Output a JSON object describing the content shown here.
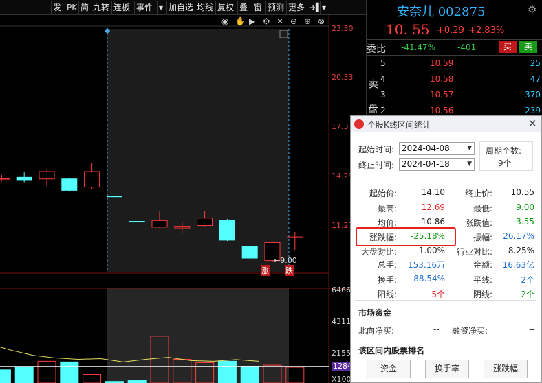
{
  "toolbar": {
    "items": [
      "发",
      "PK",
      "简",
      "九转",
      "连板",
      "事件",
      "▾",
      "加自选",
      "均线",
      "复权",
      "叠",
      "窗",
      "预测",
      "更多",
      "➜▌",
      "▾"
    ]
  },
  "chart": {
    "price_ticks": [
      "23.30",
      "20.33",
      "17.3",
      "14.29",
      "11.27"
    ],
    "volume_ticks": [
      "6466",
      "4311",
      "2155",
      "1284",
      "X100"
    ],
    "low_marker": "9.00",
    "zhang_label": "涨",
    "die_label": "跌",
    "candles": [
      {
        "open": 14.13,
        "close": 14.13,
        "high": 14.35,
        "low": 13.95,
        "color": "red",
        "filled": false
      },
      {
        "open": 14.2,
        "close": 14.05,
        "high": 14.5,
        "low": 13.9,
        "color": "cyan",
        "filled": true
      },
      {
        "open": 14.1,
        "close": 14.55,
        "high": 14.7,
        "low": 13.65,
        "color": "red",
        "filled": false
      },
      {
        "open": 14.1,
        "close": 13.4,
        "high": 14.2,
        "low": 13.3,
        "color": "cyan",
        "filled": true
      },
      {
        "open": 13.6,
        "close": 14.55,
        "high": 15.05,
        "low": 13.5,
        "color": "red",
        "filled": false
      },
      {
        "open": 13.05,
        "close": 13.05,
        "high": 13.05,
        "low": 13.05,
        "color": "cyan",
        "filled": true
      },
      {
        "open": 11.5,
        "close": 11.5,
        "high": 11.5,
        "low": 11.5,
        "color": "cyan",
        "filled": true
      },
      {
        "open": 11.15,
        "close": 11.55,
        "high": 12.1,
        "low": 11.1,
        "color": "red",
        "filled": false
      },
      {
        "open": 11.2,
        "close": 11.1,
        "high": 11.5,
        "low": 10.8,
        "color": "red",
        "filled": false
      },
      {
        "open": 11.25,
        "close": 11.7,
        "high": 12.15,
        "low": 11.2,
        "color": "red",
        "filled": false
      },
      {
        "open": 11.55,
        "close": 10.35,
        "high": 11.65,
        "low": 10.3,
        "color": "cyan",
        "filled": true
      },
      {
        "open": 9.95,
        "close": 9.25,
        "high": 9.95,
        "low": 9.2,
        "color": "cyan",
        "filled": true
      },
      {
        "open": 9.1,
        "close": 10.2,
        "high": 10.2,
        "low": 9.0,
        "color": "red",
        "filled": false
      },
      {
        "open": 10.55,
        "close": 10.55,
        "high": 10.85,
        "low": 9.75,
        "color": "red",
        "filled": false
      }
    ],
    "volumes": [
      {
        "v": 1000,
        "color": "cyan",
        "filled": true
      },
      {
        "v": 1230,
        "color": "cyan",
        "filled": true
      },
      {
        "v": 1650,
        "color": "red",
        "filled": false
      },
      {
        "v": 1600,
        "color": "cyan",
        "filled": true
      },
      {
        "v": 650,
        "color": "red",
        "filled": false
      },
      {
        "v": 120,
        "color": "cyan",
        "filled": true
      },
      {
        "v": 180,
        "color": "cyan",
        "filled": true
      },
      {
        "v": 3550,
        "color": "red",
        "filled": false
      },
      {
        "v": 1800,
        "color": "red",
        "filled": false
      },
      {
        "v": 1540,
        "color": "red",
        "filled": false
      },
      {
        "v": 1650,
        "color": "cyan",
        "filled": true
      },
      {
        "v": 1250,
        "color": "cyan",
        "filled": true
      },
      {
        "v": 1350,
        "color": "red",
        "filled": false
      },
      {
        "v": 1200,
        "color": "red",
        "filled": false
      }
    ],
    "volume_ma": [
      {
        "x": 0,
        "v": 3000
      },
      {
        "x": 1,
        "v": 2500
      },
      {
        "x": 2,
        "v": 2100
      },
      {
        "x": 3,
        "v": 1900
      },
      {
        "x": 4,
        "v": 1800
      },
      {
        "x": 5,
        "v": 1850
      },
      {
        "x": 6,
        "v": 1600
      },
      {
        "x": 7,
        "v": 1800
      },
      {
        "x": 8,
        "v": 1950
      },
      {
        "x": 9,
        "v": 1700
      },
      {
        "x": 10,
        "v": 1650
      },
      {
        "x": 11,
        "v": 1780
      },
      {
        "x": 12,
        "v": 1650
      }
    ],
    "colors": {
      "red": "#ff3c3c",
      "cyan": "#54ffff",
      "ma": "#e8e060",
      "white_ma": "#ffffff"
    }
  },
  "quote": {
    "title": "安奈儿 002875",
    "price": "10. 55",
    "change": "+0.29",
    "change_pct": "+2.83%",
    "wb_label": "委比",
    "wb": "-41.47%",
    "wc": "-401",
    "buy": "买",
    "sell": "卖",
    "side_chars": [
      "卖",
      "盘"
    ],
    "asks": [
      {
        "level": "5",
        "price": "10.59",
        "vol": "25"
      },
      {
        "level": "4",
        "price": "10.58",
        "vol": "47"
      },
      {
        "level": "3",
        "price": "10.57",
        "vol": "370"
      },
      {
        "level": "2",
        "price": "10.56",
        "vol": "239"
      }
    ]
  },
  "dialog": {
    "title": "个股K线区间统计",
    "start_label": "起始时间:",
    "start_value": "2024-04-08",
    "end_label": "终止时间:",
    "end_value": "2024-04-18",
    "cycle_label": "周期个数:",
    "cycle_value": "9个",
    "stats": [
      {
        "l": "起始价:",
        "v": "14.10",
        "c": "dark",
        "r": "终止价:",
        "rv": "10.55",
        "rc": "dark"
      },
      {
        "l": "最高:",
        "v": "12.69",
        "c": "red",
        "r": "最低:",
        "rv": "9.00",
        "rc": "green"
      },
      {
        "l": "均价:",
        "v": "10.86",
        "c": "dark",
        "r": "涨跌值:",
        "rv": "-3.55",
        "rc": "green"
      },
      {
        "l": "涨跌幅:",
        "v": "-25.18%",
        "c": "green",
        "r": "振幅:",
        "rv": "26.17%",
        "rc": "blue"
      },
      {
        "l": "大盘对比:",
        "v": "-1.00%",
        "c": "dark",
        "r": "行业对比:",
        "rv": "-8.25%",
        "rc": "dark"
      },
      {
        "l": "总手:",
        "v": "153.16万",
        "c": "blue",
        "r": "金额:",
        "rv": "16.63亿",
        "rc": "blue"
      },
      {
        "l": "换手:",
        "v": "88.54%",
        "c": "blue",
        "r": "平线:",
        "rv": "2个",
        "rc": "blue"
      },
      {
        "l": "阳线:",
        "v": "5个",
        "c": "red",
        "r": "阴线:",
        "rv": "2个",
        "rc": "green"
      }
    ],
    "market_section": "市场资金",
    "north_label": "北向净买:",
    "north_value": "--",
    "margin_label": "融资净买:",
    "margin_value": "--",
    "rank_section": "该区间内股票排名",
    "btn_fund": "资金",
    "btn_turnover": "换手率",
    "btn_change": "涨跌幅"
  }
}
